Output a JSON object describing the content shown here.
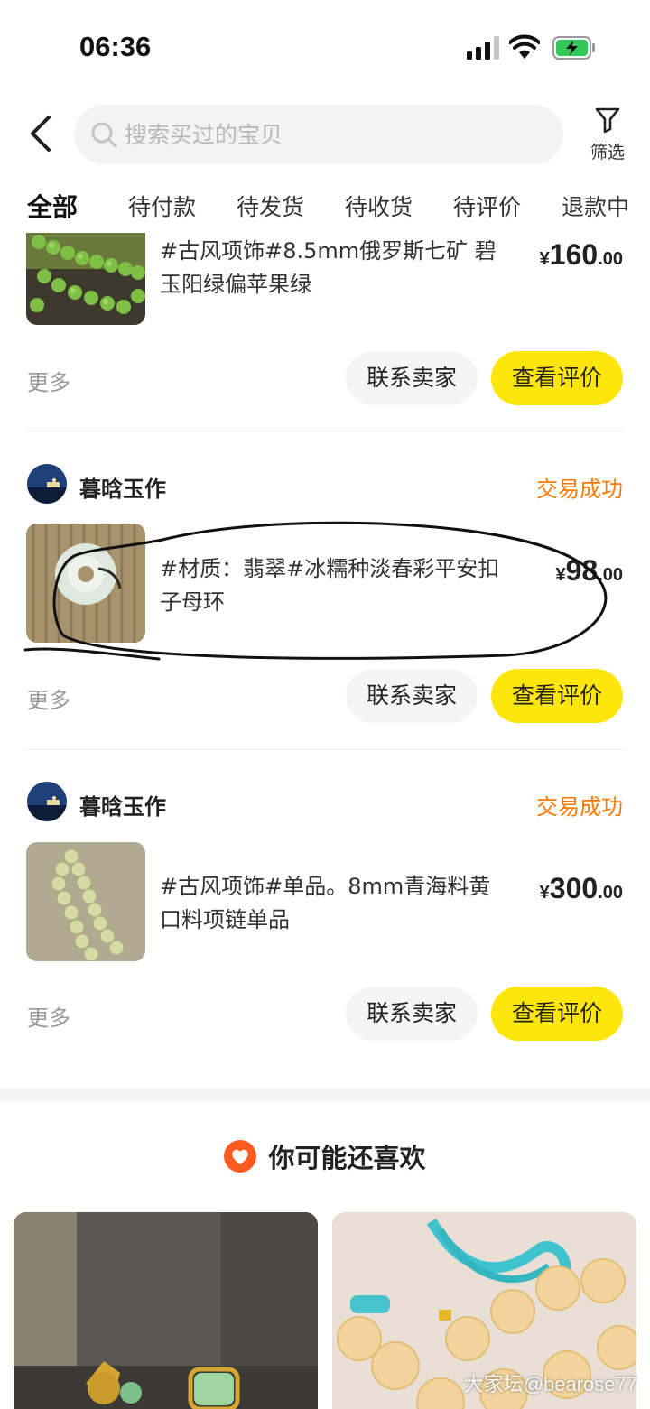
{
  "status_bar": {
    "time": "06:36"
  },
  "header": {
    "search_placeholder": "搜索买过的宝贝",
    "filter_label": "筛选"
  },
  "tabs": [
    {
      "label": "全部",
      "active": true
    },
    {
      "label": "待付款"
    },
    {
      "label": "待发货"
    },
    {
      "label": "待收货"
    },
    {
      "label": "待评价"
    },
    {
      "label": "退款中"
    }
  ],
  "orders": [
    {
      "title": "#古风项饰#8.5mm俄罗斯七矿 碧玉阳绿偏苹果绿",
      "price": {
        "symbol": "¥",
        "int": "160",
        "dec": ".00"
      },
      "more": "更多",
      "contact": "联系卖家",
      "review": "查看评价"
    },
    {
      "shop": "暮晗玉作",
      "status": "交易成功",
      "title": "#材质：翡翠#冰糯种淡春彩平安扣子母环",
      "price": {
        "symbol": "¥",
        "int": "98",
        "dec": ".00"
      },
      "more": "更多",
      "contact": "联系卖家",
      "review": "查看评价"
    },
    {
      "shop": "暮晗玉作",
      "status": "交易成功",
      "title": "#古风项饰#单品。8mm青海料黄口料项链单品",
      "price": {
        "symbol": "¥",
        "int": "300",
        "dec": ".00"
      },
      "more": "更多",
      "contact": "联系卖家",
      "review": "查看评价"
    }
  ],
  "recommend": {
    "title": "你可能还喜欢"
  },
  "watermark": "大家坛@bearose77",
  "colors": {
    "accent_yellow": "#ffe60a",
    "status_orange": "#ff7a00",
    "heart_red": "#ff5a1f"
  }
}
